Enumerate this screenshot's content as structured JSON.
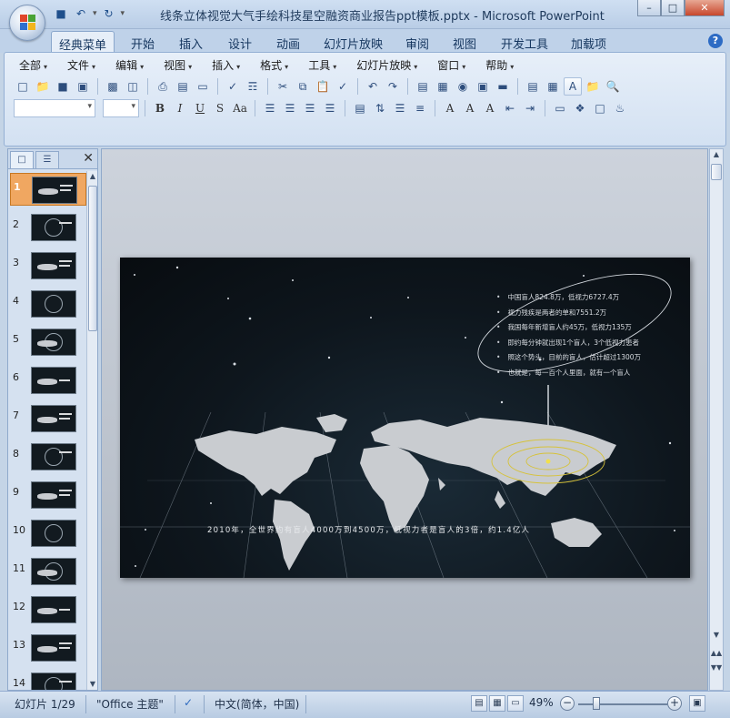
{
  "window": {
    "title": "线条立体视觉大气手绘科技星空融资商业报告ppt模板.pptx - Microsoft PowerPoint",
    "controls": [
      "–",
      "□",
      "✕"
    ]
  },
  "qat": {
    "icons": [
      "save-icon",
      "undo-icon",
      "redo-icon",
      "customize-icon"
    ]
  },
  "ribbon_tabs": [
    "经典菜单",
    "开始",
    "插入",
    "设计",
    "动画",
    "幻灯片放映",
    "审阅",
    "视图",
    "开发工具",
    "加载项"
  ],
  "menu": [
    "全部",
    "文件",
    "编辑",
    "视图",
    "插入",
    "格式",
    "工具",
    "幻灯片放映",
    "窗口",
    "帮助"
  ],
  "toolbar_format": {
    "bold": "B",
    "italic": "I",
    "underline": "U",
    "shadow": "S",
    "case": "Aa",
    "font_a": "A"
  },
  "panel": {
    "tab_slides_icon": "slides-tab-icon",
    "tab_outline_icon": "outline-tab-icon",
    "close": "✕"
  },
  "thumbnails": [
    "1",
    "2",
    "3",
    "4",
    "5",
    "6",
    "7",
    "8",
    "9",
    "10",
    "11",
    "12",
    "13",
    "14"
  ],
  "slide": {
    "bullets": [
      "中国盲人824.8万，低视力6727.4万",
      "视力残疾是两者的单和7551.2万",
      "我国每年新增盲人约45万，低视力135万",
      "即约每分钟就出现1个盲人，3个低视力患者",
      "照这个势头，目前的盲人，估计超过1300万",
      "也就是，每一百个人里面，就有一个盲人"
    ],
    "caption": "2010年，全世界约有盲人4000万到4500万，低视力者是盲人的3倍，约1.4亿人"
  },
  "status": {
    "slide_info": "幻灯片 1/29",
    "theme": "\"Office 主题\"",
    "language": "中文(简体，中国)",
    "zoom": "49%",
    "zoom_minus": "−",
    "zoom_plus": "+"
  }
}
